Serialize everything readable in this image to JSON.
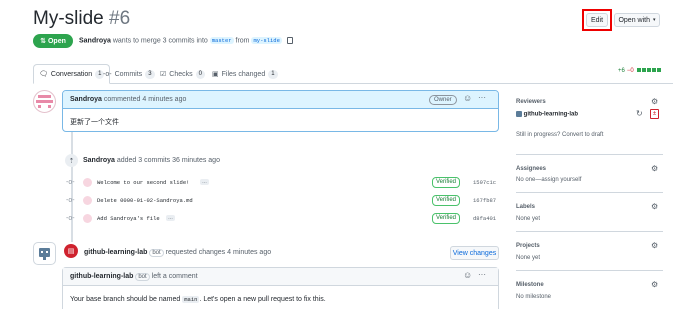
{
  "header": {
    "title": "My-slide",
    "number": "#6",
    "edit_label": "Edit",
    "open_with_label": "Open with",
    "state_label": "Open",
    "author": "Sandroya",
    "merge_text_1": "wants to merge 3 commits into",
    "base_branch": "master",
    "merge_text_2": "from",
    "head_branch": "my-slide"
  },
  "tabs": [
    {
      "label": "Conversation",
      "count": "1"
    },
    {
      "label": "Commits",
      "count": "3"
    },
    {
      "label": "Checks",
      "count": "0"
    },
    {
      "label": "Files changed",
      "count": "1"
    }
  ],
  "diffstat": {
    "additions": "+6",
    "deletions": "−0"
  },
  "comment1": {
    "author": "Sandroya",
    "action": "commented 4 minutes ago",
    "badge": "Owner",
    "body": "更新了一个文件"
  },
  "commits_event": {
    "author": "Sandroya",
    "action": "added 3 commits 36 minutes ago",
    "commits": [
      {
        "message": "Welcome to our second slide!",
        "has_more": true,
        "ellipsis": "…",
        "verified": "Verified",
        "sha": "1597c1c"
      },
      {
        "message": "Delete 0000-01-02-Sandroya.md",
        "has_more": false,
        "ellipsis": "",
        "verified": "Verified",
        "sha": "167fb87"
      },
      {
        "message": "Add Sandroya's file",
        "has_more": true,
        "ellipsis": "…",
        "verified": "Verified",
        "sha": "d8fa401"
      }
    ]
  },
  "review": {
    "author": "github-learning-lab",
    "bot": "bot",
    "action": "requested changes 4 minutes ago",
    "view_changes": "View changes"
  },
  "comment2": {
    "author": "github-learning-lab",
    "bot": "bot",
    "action": "left a comment",
    "body_1": "Your base branch should be named",
    "body_code": "main",
    "body_2": ". Let's open a new pull request to fix this."
  },
  "sidebar": {
    "reviewers_label": "Reviewers",
    "reviewer_name": "github-learning-lab",
    "reviewers_hint": "Still in progress? Convert to draft",
    "assignees_label": "Assignees",
    "assignees_value": "No one—assign yourself",
    "labels_label": "Labels",
    "labels_value": "None yet",
    "projects_label": "Projects",
    "projects_value": "None yet",
    "milestone_label": "Milestone",
    "milestone_value": "No milestone"
  },
  "colors": {
    "open_green": "#2da44e",
    "link_blue": "#0969da",
    "danger_red": "#cf222e",
    "highlight_red": "#ee0000"
  }
}
